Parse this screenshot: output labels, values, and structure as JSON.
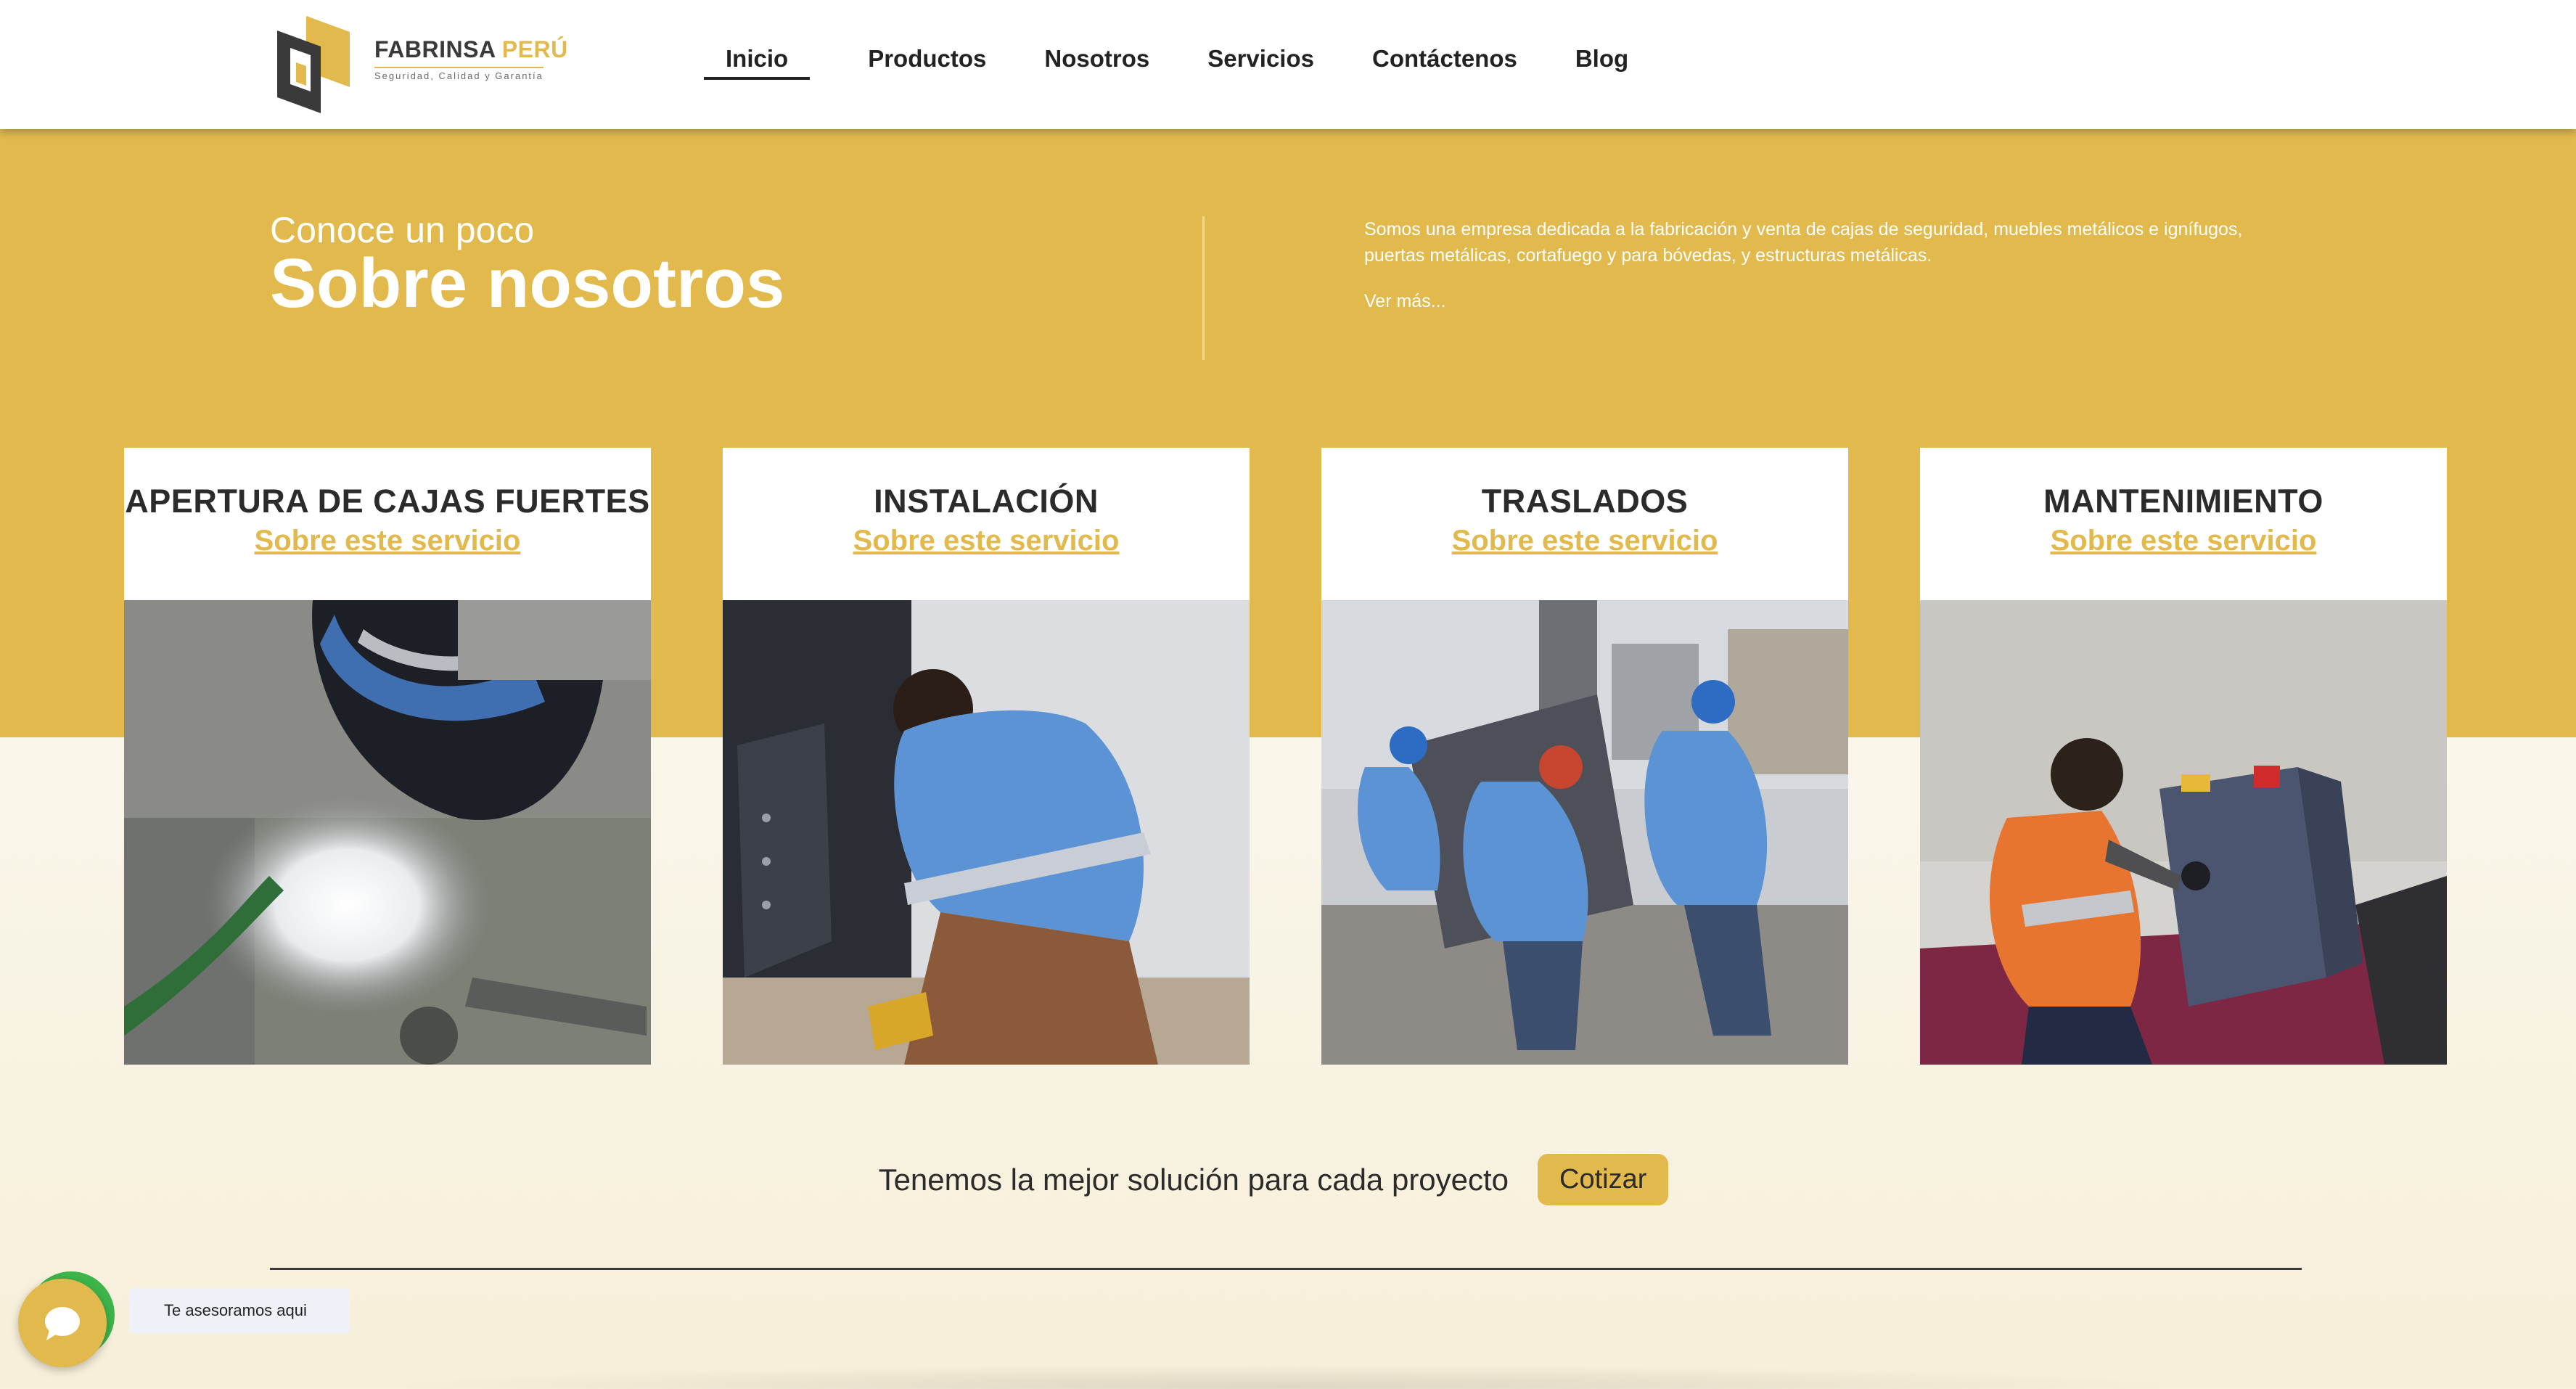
{
  "brand": {
    "name_main": "FABRINSA",
    "name_accent": "PERÚ",
    "tagline": "Seguridad, Calidad y Garantía",
    "colors": {
      "accent": "#e1b94c",
      "dark": "#3a3a3a",
      "whatsapp": "#3eb54a"
    }
  },
  "nav": {
    "items": [
      {
        "label": "Inicio",
        "active": true
      },
      {
        "label": "Productos"
      },
      {
        "label": "Nosotros"
      },
      {
        "label": "Servicios"
      },
      {
        "label": "Contáctenos"
      },
      {
        "label": "Blog"
      }
    ]
  },
  "about": {
    "kicker": "Conoce un poco",
    "title": "Sobre nosotros",
    "description": "Somos una empresa dedicada a la fabricación y venta de cajas de seguridad, muebles metálicos e ignífugos, puertas metálicas, cortafuego y para bóvedas, y estructuras metálicas.",
    "more": "Ver más..."
  },
  "services": [
    {
      "title": "APERTURA DE CAJAS FUERTES",
      "link": "Sobre este servicio"
    },
    {
      "title": "INSTALACIÓN",
      "link": "Sobre este servicio"
    },
    {
      "title": "TRASLADOS",
      "link": "Sobre este servicio"
    },
    {
      "title": "MANTENIMIENTO",
      "link": "Sobre este servicio"
    }
  ],
  "cta": {
    "text": "Tenemos la mejor solución para cada proyecto",
    "button": "Cotizar"
  },
  "chat": {
    "tooltip": "Te asesoramos aqui",
    "icon": "chat-bubble-icon"
  }
}
